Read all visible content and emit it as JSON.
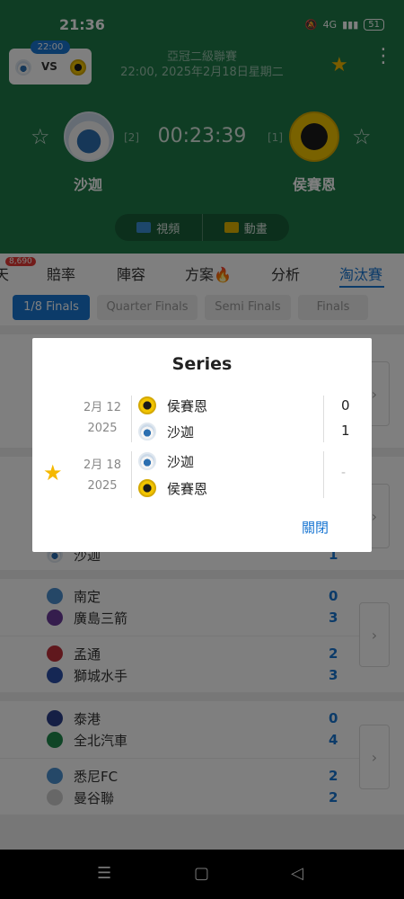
{
  "status": {
    "time": "21:36",
    "network": "4G",
    "battery": "51"
  },
  "mini_score": {
    "kickoff": "22:00",
    "vs": "VS"
  },
  "match": {
    "league": "亞冠二級聯賽",
    "datetime": "22:00, 2025年2月18日星期二",
    "home": {
      "name": "沙迦",
      "rank": "[2]"
    },
    "away": {
      "name": "侯賽恩",
      "rank": "[1]"
    },
    "timer": "00:23:39"
  },
  "media": {
    "video": "視頻",
    "animation": "動畫"
  },
  "tabs": {
    "badge": "8,690",
    "items": [
      "天",
      "賠率",
      "陣容",
      "方案",
      "分析",
      "淘汰賽"
    ],
    "active": "淘汰賽"
  },
  "rounds": [
    "1/8 Finals",
    "Quarter Finals",
    "Semi Finals",
    "Finals"
  ],
  "groups": [
    {
      "rows": [
        {
          "home": "南定",
          "home_score": "0",
          "away": "廣島三箭",
          "away_score": "3"
        },
        {
          "home": "孟通",
          "home_score": "2",
          "away": "獅城水手",
          "away_score": "3"
        }
      ]
    },
    {
      "rows": [
        {
          "home": "泰港",
          "home_score": "0",
          "away": "全北汽車",
          "away_score": "4"
        },
        {
          "home": "悉尼FC",
          "home_score": "2",
          "away": "曼谷聯",
          "away_score": "2"
        }
      ]
    }
  ],
  "partial_row": {
    "team": "沙迦",
    "score": "1"
  },
  "dialog": {
    "title": "Series",
    "matches": [
      {
        "date": "2月 12",
        "year": "2025",
        "home": "侯賽恩",
        "home_score": "0",
        "away": "沙迦",
        "away_score": "1"
      },
      {
        "date": "2月 18",
        "year": "2025",
        "home": "沙迦",
        "home_score": "",
        "away": "侯賽恩",
        "away_score": "",
        "pending": "-"
      }
    ],
    "close": "關閉"
  },
  "colors": {
    "header": "#1f7a48",
    "accent": "#1976d2",
    "star": "#f5b800"
  }
}
